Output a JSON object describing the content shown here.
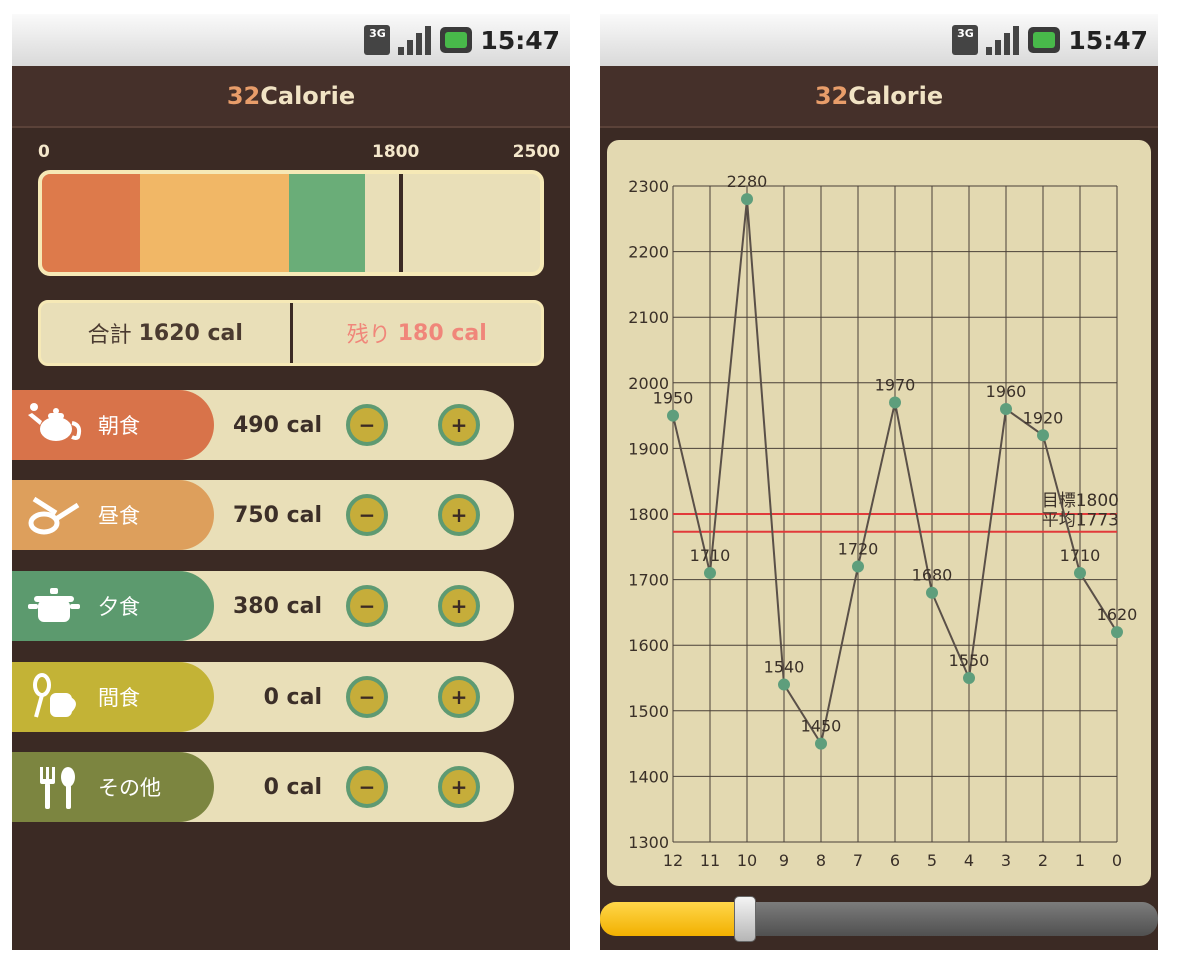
{
  "status_bar": {
    "network": "3G",
    "time": "15:47"
  },
  "app": {
    "title_num": "32",
    "title_word": "Calorie"
  },
  "gauge": {
    "scale_min": "0",
    "scale_goal": "1800",
    "scale_max": "2500",
    "min": 0,
    "goal": 1800,
    "max": 2500,
    "segments": [
      {
        "meal": "朝食",
        "value": 490,
        "color": "#dd7a4b"
      },
      {
        "meal": "昼食",
        "value": 750,
        "color": "#f1b766"
      },
      {
        "meal": "夕食",
        "value": 380,
        "color": "#6aad78"
      },
      {
        "meal": "間食",
        "value": 0,
        "color": "#c9b93f"
      },
      {
        "meal": "その他",
        "value": 0,
        "color": "#8a8f4a"
      }
    ]
  },
  "summary": {
    "total_label": "合計",
    "total_value": "1620 cal",
    "remain_label": "残り",
    "remain_value": "180 cal"
  },
  "meals": [
    {
      "name": "朝食",
      "calories": "490 cal",
      "icon": "teapot-icon",
      "color": "#d8734a"
    },
    {
      "name": "昼食",
      "calories": "750 cal",
      "icon": "frying-pan-icon",
      "color": "#dd9f5c"
    },
    {
      "name": "夕食",
      "calories": "380 cal",
      "icon": "pot-icon",
      "color": "#5c9a6e"
    },
    {
      "name": "間食",
      "calories": "0 cal",
      "icon": "whisk-cup-icon",
      "color": "#c3b336"
    },
    {
      "name": "その他",
      "calories": "0 cal",
      "icon": "fork-spoon-icon",
      "color": "#7c8540"
    }
  ],
  "controls": {
    "minus": "−",
    "plus": "+"
  },
  "chart_data": {
    "type": "line",
    "x": [
      "12",
      "11",
      "10",
      "9",
      "8",
      "7",
      "6",
      "5",
      "4",
      "3",
      "2",
      "1",
      "0"
    ],
    "values": [
      1950,
      1710,
      2280,
      1540,
      1450,
      1720,
      1970,
      1680,
      1550,
      1960,
      1920,
      1710,
      1620
    ],
    "ylim": [
      1300,
      2300
    ],
    "yticks": [
      1300,
      1400,
      1500,
      1600,
      1700,
      1800,
      1900,
      2000,
      2100,
      2200,
      2300
    ],
    "reference_lines": [
      {
        "label": "目標1800",
        "value": 1800,
        "color": "#e23a3a"
      },
      {
        "label": "平均1773",
        "value": 1773,
        "color": "#e23a3a"
      }
    ],
    "grid": true,
    "line_color": "#5a5048",
    "marker_color": "#5e9e7c"
  },
  "range_slider": {
    "value": 0.26
  }
}
